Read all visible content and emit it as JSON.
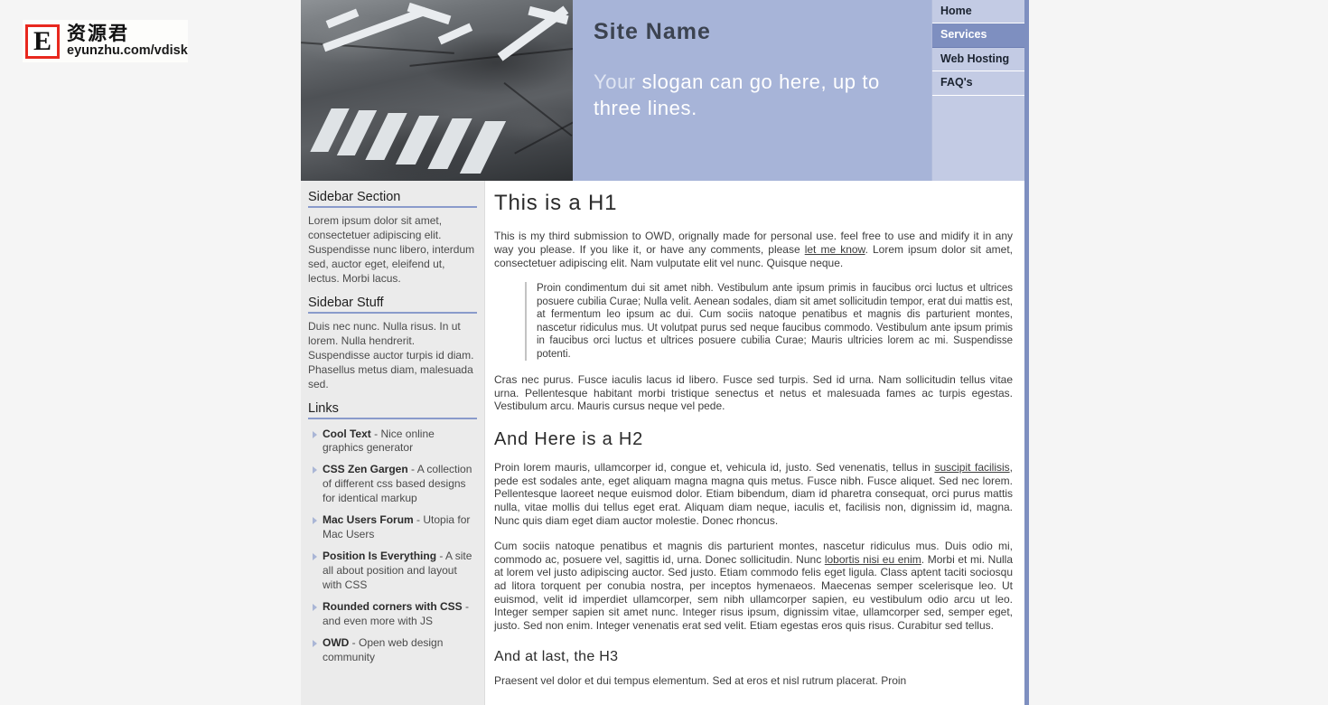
{
  "watermark": {
    "badge_letter": "E",
    "chinese": "资源君",
    "url": "eyunzhu.com/vdisk"
  },
  "header": {
    "site_name": "Site Name",
    "slogan_lead": "Your ",
    "slogan_rest": "slogan can go here, up to three lines.",
    "photo_alt": "road-asphalt-arrows-photo",
    "nav": [
      {
        "label": "Home",
        "active": false
      },
      {
        "label": "Services",
        "active": true
      },
      {
        "label": "Web Hosting",
        "active": false
      },
      {
        "label": "FAQ's",
        "active": false
      }
    ]
  },
  "sidebar": {
    "section_title": "Sidebar Section",
    "section_text": "Lorem ipsum dolor sit amet, consectetuer adipiscing elit. Suspendisse nunc libero, interdum sed, auctor eget, eleifend ut, lectus. Morbi lacus.",
    "stuff_title": "Sidebar Stuff",
    "stuff_text": "Duis nec nunc. Nulla risus. In ut lorem. Nulla hendrerit. Suspendisse auctor turpis id diam. Phasellus metus diam, malesuada sed.",
    "links_title": "Links",
    "links": [
      {
        "label": "Cool Text",
        "desc": " - Nice online graphics generator"
      },
      {
        "label": "CSS Zen Gargen",
        "desc": " - A collection of different css based designs for identical markup"
      },
      {
        "label": "Mac Users Forum",
        "desc": " - Utopia for Mac Users"
      },
      {
        "label": "Position Is Everything",
        "desc": " - A site all about position and layout with CSS"
      },
      {
        "label": "Rounded corners with CSS",
        "desc": " - and even more with JS"
      },
      {
        "label": "OWD",
        "desc": " - Open web design community"
      }
    ]
  },
  "content": {
    "h1": "This is a H1",
    "p1_a": "This is my third submission to OWD, orignally made for personal use. feel free to use and midify it in any way you please. If you like it, or have any comments, please ",
    "p1_link": "let me know",
    "p1_b": ". Lorem ipsum dolor sit amet, consectetuer adipiscing elit. Nam vulputate elit vel nunc. Quisque neque.",
    "blockquote": "Proin condimentum dui sit amet nibh. Vestibulum ante ipsum primis in faucibus orci luctus et ultrices posuere cubilia Curae; Nulla velit. Aenean sodales, diam sit amet sollicitudin tempor, erat dui mattis est, at fermentum leo ipsum ac dui. Cum sociis natoque penatibus et magnis dis parturient montes, nascetur ridiculus mus. Ut volutpat purus sed neque faucibus commodo. Vestibulum ante ipsum primis in faucibus orci luctus et ultrices posuere cubilia Curae; Mauris ultricies lorem ac mi. Suspendisse potenti.",
    "p2": "Cras nec purus. Fusce iaculis lacus id libero. Fusce sed turpis. Sed id urna. Nam sollicitudin tellus vitae urna. Pellentesque habitant morbi tristique senectus et netus et malesuada fames ac turpis egestas. Vestibulum arcu. Mauris cursus neque vel pede.",
    "h2": "And Here is a H2",
    "p3_a": "Proin lorem mauris, ullamcorper id, congue et, vehicula id, justo. Sed venenatis, tellus in ",
    "p3_link": "suscipit facilisis",
    "p3_b": ", pede est sodales ante, eget aliquam magna magna quis metus. Fusce nibh. Fusce aliquet. Sed nec lorem. Pellentesque laoreet neque euismod dolor. Etiam bibendum, diam id pharetra consequat, orci purus mattis nulla, vitae mollis dui tellus eget erat. Aliquam diam neque, iaculis et, facilisis non, dignissim id, magna. Nunc quis diam eget diam auctor molestie. Donec rhoncus.",
    "p4_a": "Cum sociis natoque penatibus et magnis dis parturient montes, nascetur ridiculus mus. Duis odio mi, commodo ac, posuere vel, sagittis id, urna. Donec sollicitudin. Nunc ",
    "p4_link": "lobortis nisi eu enim",
    "p4_b": ". Morbi et mi. Nulla at lorem vel justo adipiscing auctor. Sed justo. Etiam commodo felis eget ligula. Class aptent taciti sociosqu ad litora torquent per conubia nostra, per inceptos hymenaeos. Maecenas semper scelerisque leo. Ut euismod, velit id imperdiet ullamcorper, sem nibh ullamcorper sapien, eu vestibulum odio arcu ut leo. Integer semper sapien sit amet nunc. Integer risus ipsum, dignissim vitae, ullamcorper sed, semper eget, justo. Sed non enim. Integer venenatis erat sed velit. Etiam egestas eros quis risus. Curabitur sed tellus.",
    "h3": "And at last, the H3",
    "p5": "Praesent vel dolor et dui tempus elementum. Sed at eros et nisl rutrum placerat. Proin"
  },
  "colors": {
    "header_bg": "#a7b4d8",
    "nav_bg": "#c3cbe4",
    "nav_active": "#7e8fc0",
    "page_border": "#7e8fc0",
    "sidebar_bg": "#ebebeb",
    "rule": "#8a9bcb",
    "page_bg": "#f5f5f5"
  }
}
